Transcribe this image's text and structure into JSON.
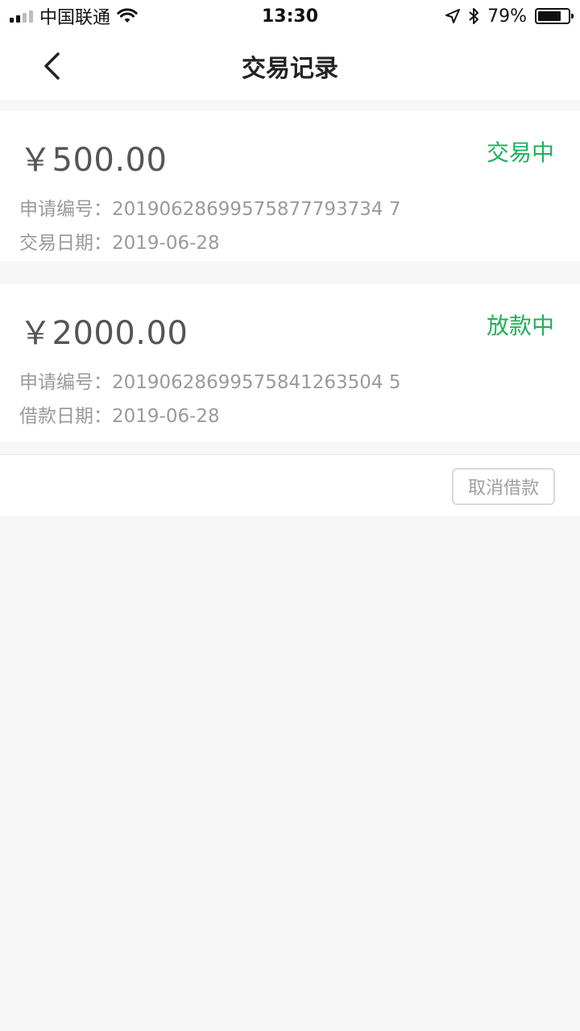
{
  "status_bar": {
    "carrier": "中国联通",
    "time": "13:30",
    "battery": "79%",
    "battery_level": 0.79,
    "icons": [
      "signal-icon",
      "wifi-icon",
      "location-arrow-icon",
      "bluetooth-icon",
      "battery-icon"
    ]
  },
  "nav": {
    "title": "交易记录",
    "back_icon": "chevron-left-icon"
  },
  "records": [
    {
      "amount": "￥500.00",
      "status": "交易中",
      "line_1": "申请编号：20190628699575877793734 7",
      "line_2": "交易日期：2019-06-28"
    },
    {
      "amount": "￥2000.00",
      "status": "放款中",
      "line_1": "申请编号：20190628699575841263504 5",
      "line_2": "借款日期：2019-06-28"
    }
  ],
  "actions": {
    "cancel_label": "取消借款"
  },
  "colors": {
    "accent_green": "#1fb05a",
    "background": "#f7f7f7",
    "text_secondary": "#9a9a9a"
  }
}
